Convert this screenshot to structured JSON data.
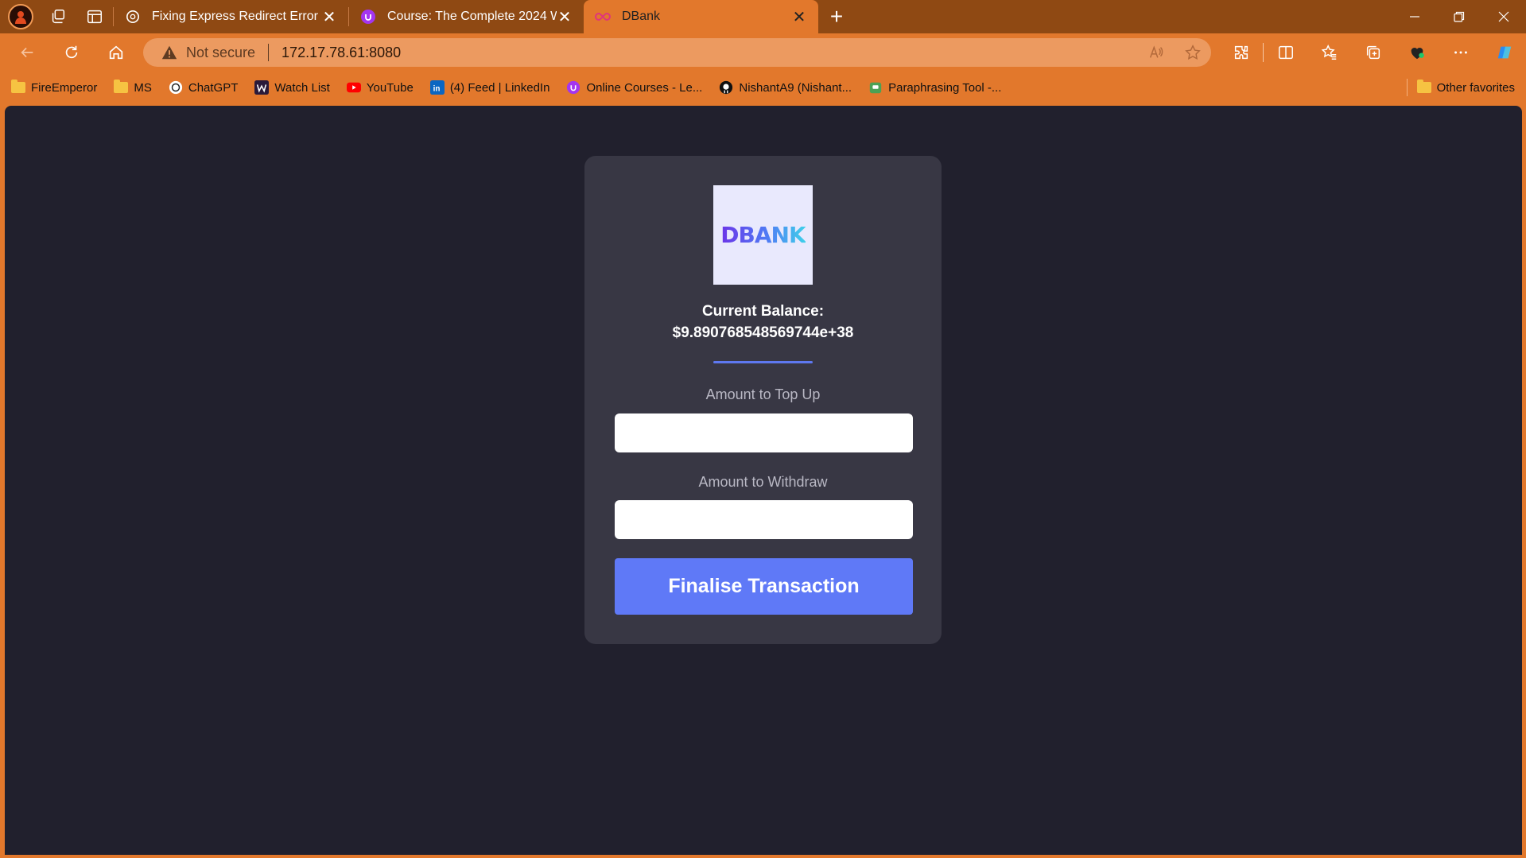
{
  "browser": {
    "tabs": [
      {
        "title": "Fixing Express Redirect Error",
        "icon": "chatgpt-icon",
        "active": false
      },
      {
        "title": "Course: The Complete 2024 Web",
        "icon": "udemy-icon",
        "active": false
      },
      {
        "title": "DBank",
        "icon": "dfinity-icon",
        "active": true
      }
    ],
    "new_tab_label": "+",
    "address": {
      "security_label": "Not secure",
      "url": "172.17.78.61:8080"
    },
    "bookmarks": [
      {
        "label": "FireEmperor",
        "icon": "folder-icon"
      },
      {
        "label": "MS",
        "icon": "folder-icon"
      },
      {
        "label": "ChatGPT",
        "icon": "chatgpt-icon"
      },
      {
        "label": "Watch List",
        "icon": "watchlist-icon"
      },
      {
        "label": "YouTube",
        "icon": "youtube-icon"
      },
      {
        "label": "(4) Feed | LinkedIn",
        "icon": "linkedin-icon"
      },
      {
        "label": "Online Courses - Le...",
        "icon": "udemy-icon"
      },
      {
        "label": "NishantA9 (Nishant...",
        "icon": "github-icon"
      },
      {
        "label": "Paraphrasing Tool -...",
        "icon": "quillbot-icon"
      }
    ],
    "other_favorites": "Other favorites"
  },
  "app": {
    "logo_text": "DBANK",
    "balance_label": "Current Balance:",
    "balance_value": "$9.890768548569744e+38",
    "topup_label": "Amount to Top Up",
    "withdraw_label": "Amount to Withdraw",
    "submit_label": "Finalise Transaction"
  },
  "colors": {
    "browser_frame": "#e2782c",
    "tab_strip": "#8f4913",
    "page_background": "#21202d",
    "card_background": "#383744",
    "accent": "#5f79f7"
  }
}
